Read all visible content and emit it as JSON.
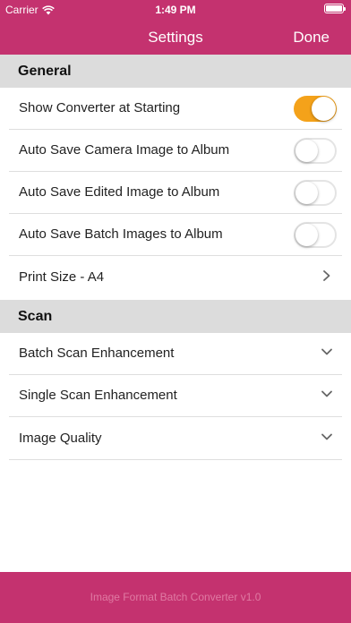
{
  "status_bar": {
    "carrier": "Carrier",
    "time": "1:49 PM"
  },
  "nav": {
    "title": "Settings",
    "done_label": "Done"
  },
  "sections": {
    "general": {
      "title": "General",
      "rows": [
        {
          "label": "Show Converter at Starting",
          "toggle": true
        },
        {
          "label": "Auto Save Camera Image to Album",
          "toggle": false
        },
        {
          "label": "Auto Save Edited Image to Album",
          "toggle": false
        },
        {
          "label": "Auto Save Batch Images to Album",
          "toggle": false
        },
        {
          "label": "Print Size - A4"
        }
      ]
    },
    "scan": {
      "title": "Scan",
      "rows": [
        {
          "label": "Batch Scan Enhancement"
        },
        {
          "label": "Single Scan Enhancement"
        },
        {
          "label": "Image Quality"
        }
      ]
    }
  },
  "footer": {
    "text": "Image Format Batch Converter v1.0"
  },
  "colors": {
    "brand": "#c4326f",
    "toggle_on": "#f4a21a",
    "section_bg": "#dcdcdc"
  }
}
